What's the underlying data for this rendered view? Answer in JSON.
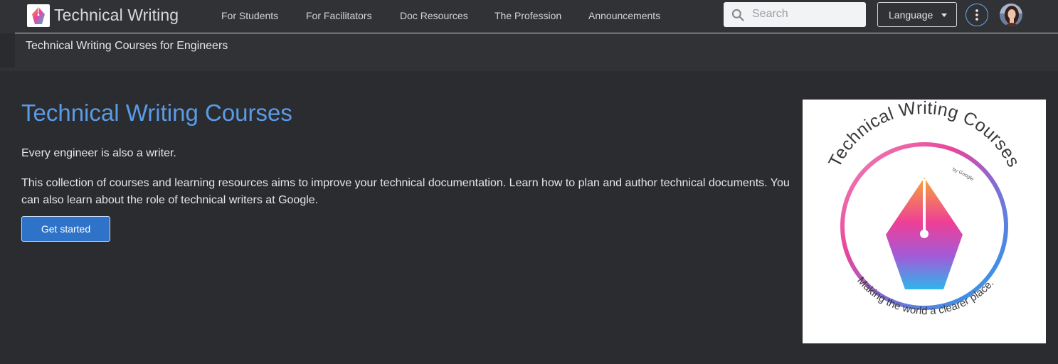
{
  "header": {
    "site_title": "Technical Writing",
    "nav": [
      {
        "label": "For Students"
      },
      {
        "label": "For Facilitators"
      },
      {
        "label": "Doc Resources"
      },
      {
        "label": "The Profession"
      },
      {
        "label": "Announcements"
      }
    ],
    "search_placeholder": "Search",
    "language_label": "Language",
    "subtitle": "Technical Writing Courses for Engineers"
  },
  "main": {
    "title": "Technical Writing Courses",
    "tagline": "Every engineer is also a writer.",
    "description": "This collection of courses and learning resources aims to improve your technical documentation. Learn how to plan and author technical documents. You can also learn about the role of technical writers at Google.",
    "cta_label": "Get started"
  },
  "hero": {
    "arc_title": "Technical Writing Courses",
    "byline": "by Google",
    "motto": "Making the world a clearer place."
  },
  "colors": {
    "background": "#2b2c2f",
    "header_bg": "#313235",
    "title_blue": "#5a9be8",
    "button_blue": "#2f73c9"
  },
  "icons": [
    "logo-icon",
    "search-icon",
    "caret-down-icon",
    "more-vert-icon",
    "avatar"
  ]
}
